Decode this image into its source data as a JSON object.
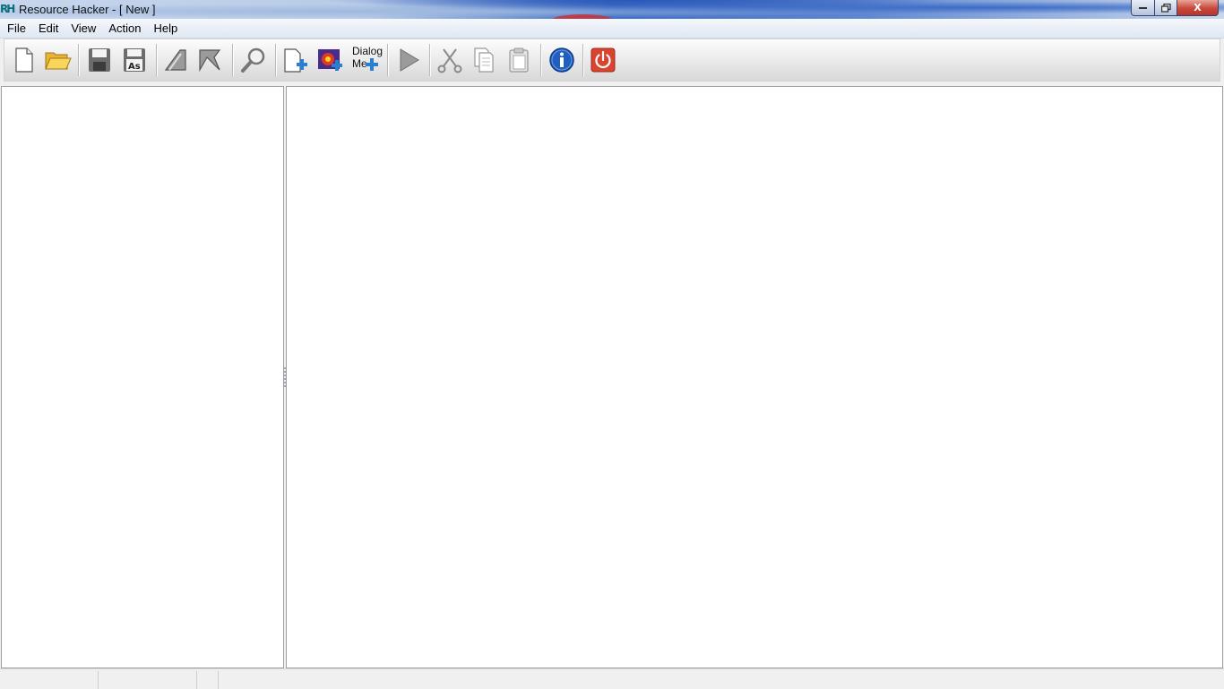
{
  "window": {
    "title": "Resource Hacker - [ New ]",
    "app_icon_text": "RH",
    "controls": {
      "minimize": "▁",
      "maximize": "❐",
      "close": "X"
    }
  },
  "menu": [
    "File",
    "Edit",
    "View",
    "Action",
    "Help"
  ],
  "toolbar": {
    "dialog_merge_label_line1": "Dialog",
    "dialog_merge_label_line2": "Me",
    "buttons": [
      {
        "name": "new-file-icon"
      },
      {
        "name": "open-folder-icon"
      },
      {
        "name": "save-icon"
      },
      {
        "name": "save-as-icon",
        "text": "As"
      },
      {
        "name": "compile-back-icon"
      },
      {
        "name": "compile-forward-icon"
      },
      {
        "name": "search-magnifier-icon"
      },
      {
        "name": "add-resource-icon"
      },
      {
        "name": "add-image-resource-icon"
      },
      {
        "name": "dialog-merger-icon"
      },
      {
        "name": "run-play-icon"
      },
      {
        "name": "cut-scissors-icon"
      },
      {
        "name": "copy-icon"
      },
      {
        "name": "paste-icon"
      },
      {
        "name": "info-icon"
      },
      {
        "name": "exit-power-icon"
      }
    ]
  },
  "status_bar": {
    "panels": [
      "",
      "",
      "",
      ""
    ]
  },
  "colors": {
    "accent_blue": "#1f5fbf",
    "exit_red": "#d9442f",
    "plus_blue": "#2a7fd4"
  }
}
